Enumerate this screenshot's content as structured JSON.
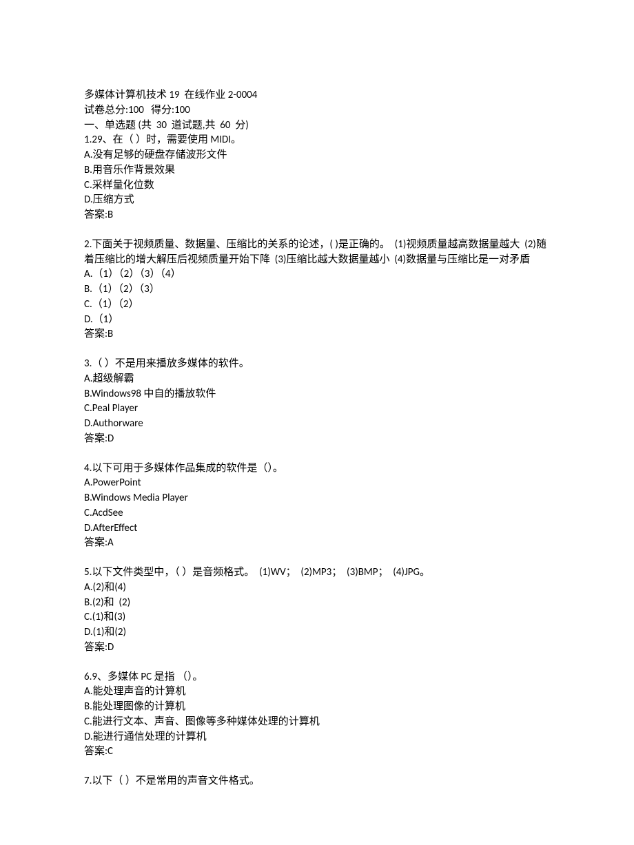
{
  "header": {
    "title": "多媒体计算机技术 19  在线作业 2-0004",
    "score_line": "试卷总分:100   得分:100",
    "section_line": "一、单选题 (共  30  道试题,共  60  分)"
  },
  "questions": [
    {
      "stem": "1.29、在（ ）时，需要使用 MIDI。",
      "options": [
        "A.没有足够的硬盘存储波形文件",
        "B.用音乐作背景效果",
        "C.采样量化位数",
        "D.压缩方式"
      ],
      "answer": "答案:B"
    },
    {
      "stem": "2.下面关于视频质量、数据量、压缩比的关系的论述，( )是正确的。  (1)视频质量越高数据量越大  (2)随着压缩比的增大解压后视频质量开始下降  (3)压缩比越大数据量越小  (4)数据量与压缩比是一对矛盾",
      "options": [
        "A.（1）（2）（3）（4）",
        "B.（1）（2）（3）",
        "C.（1）（2）",
        "D.（1）"
      ],
      "answer": "答案:B"
    },
    {
      "stem": "3.（ ）不是用来播放多媒体的软件。",
      "options": [
        "A.超级解霸",
        "B.Windows98 中自的播放软件",
        "C.Peal Player",
        "D.Authorware"
      ],
      "answer": "答案:D"
    },
    {
      "stem": "4.以下可用于多媒体作品集成的软件是（）。",
      "options": [
        "A.PowerPoint",
        "B.Windows Media Player",
        "C.AcdSee",
        "D.AfterEffect"
      ],
      "answer": "答案:A"
    },
    {
      "stem": "5.以下文件类型中，（ ）是音频格式。  (1)WV；  (2)MP3；  (3)BMP；  (4)JPG。",
      "options": [
        "A.(2)和(4)",
        "B.(2)和  (2)",
        "C.(1)和(3)",
        "D.(1)和(2)"
      ],
      "answer": "答案:D"
    },
    {
      "stem": "6.9、多媒体 PC 是指 （）。",
      "options": [
        "A.能处理声音的计算机",
        "B.能处理图像的计算机",
        "C.能进行文本、声音、图像等多种媒体处理的计算机",
        "D.能进行通信处理的计算机"
      ],
      "answer": "答案:C"
    },
    {
      "stem": "7.以下（ ）不是常用的声音文件格式。",
      "options": [],
      "answer": ""
    }
  ]
}
